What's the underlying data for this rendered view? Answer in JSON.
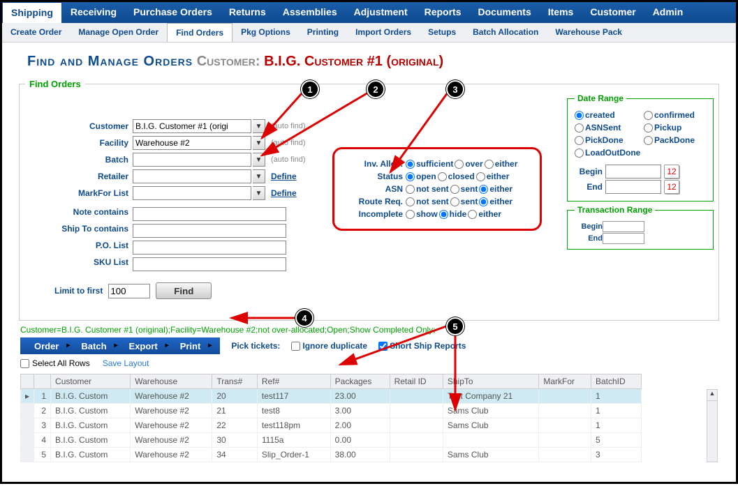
{
  "topnav": [
    "Shipping",
    "Receiving",
    "Purchase Orders",
    "Returns",
    "Assemblies",
    "Adjustment",
    "Reports",
    "Documents",
    "Items",
    "Customer",
    "Admin"
  ],
  "subnav": [
    "Create Order",
    "Manage Open Order",
    "Find Orders",
    "Pkg Options",
    "Printing",
    "Import Orders",
    "Setups",
    "Batch Allocation",
    "Warehouse Pack"
  ],
  "subnav_active": 2,
  "title": {
    "main": "Find and Manage Orders",
    "cust": "Customer:",
    "name": "B.I.G. Customer #1 (original)"
  },
  "section_legend": "Find Orders",
  "form": {
    "customer_lbl": "Customer",
    "customer_val": "B.I.G. Customer #1 (origi",
    "customer_auto": "(auto find)",
    "facility_lbl": "Facility",
    "facility_val": "Warehouse #2",
    "facility_auto": "(auto find)",
    "batch_lbl": "Batch",
    "batch_auto": "(auto find)",
    "retailer_lbl": "Retailer",
    "retailer_define": "Define",
    "markfor_lbl": "MarkFor List",
    "markfor_define": "Define",
    "note_lbl": "Note contains",
    "shipto_lbl": "Ship To contains",
    "po_lbl": "P.O. List",
    "sku_lbl": "SKU List"
  },
  "filters": {
    "inv_alloc": {
      "lbl": "Inv. Alloc.",
      "opts": [
        "sufficient",
        "over",
        "either"
      ],
      "sel": 0
    },
    "status": {
      "lbl": "Status",
      "opts": [
        "open",
        "closed",
        "either"
      ],
      "sel": 0
    },
    "asn": {
      "lbl": "ASN",
      "opts": [
        "not sent",
        "sent",
        "either"
      ],
      "sel": 2
    },
    "route": {
      "lbl": "Route Req.",
      "opts": [
        "not sent",
        "sent",
        "either"
      ],
      "sel": 2
    },
    "incomplete": {
      "lbl": "Incomplete",
      "opts": [
        "show",
        "hide",
        "either"
      ],
      "sel": 1
    }
  },
  "daterange": {
    "legend": "Date Range",
    "opts": [
      "created",
      "confirmed",
      "ASNSent",
      "Pickup",
      "PickDone",
      "PackDone",
      "LoadOutDone"
    ],
    "sel": 0,
    "begin_lbl": "Begin",
    "end_lbl": "End",
    "cal": "12"
  },
  "transrange": {
    "legend": "Transaction Range",
    "begin_lbl": "Begin",
    "end_lbl": "End"
  },
  "limit": {
    "lbl": "Limit to first",
    "val": "100",
    "btn": "Find"
  },
  "summary": "Customer=B.I.G. Customer #1 (original);Facility=Warehouse #2;not over-allocated;Open;Show Completed Only;",
  "menubar": [
    "Order",
    "Batch",
    "Export",
    "Print"
  ],
  "pick_tickets_lbl": "Pick tickets:",
  "ignore_dup": "Ignore duplicate",
  "short_ship": "Short Ship Reports",
  "select_all": "Select All Rows",
  "save_layout": "Save Layout",
  "table": {
    "cols": [
      "Customer",
      "Warehouse",
      "Trans#",
      "Ref#",
      "Packages",
      "Retail ID",
      "ShipTo",
      "MarkFor",
      "BatchID"
    ],
    "rows": [
      {
        "n": "1",
        "customer": "B.I.G. Custom",
        "warehouse": "Warehouse #2",
        "trans": "20",
        "ref": "test117",
        "pkg": "23.00",
        "retail": "",
        "shipto": "Test Company 21",
        "markfor": "",
        "batch": "1",
        "sel": true
      },
      {
        "n": "2",
        "customer": "B.I.G. Custom",
        "warehouse": "Warehouse #2",
        "trans": "21",
        "ref": "test8",
        "pkg": "3.00",
        "retail": "",
        "shipto": "Sams Club",
        "markfor": "",
        "batch": "1"
      },
      {
        "n": "3",
        "customer": "B.I.G. Custom",
        "warehouse": "Warehouse #2",
        "trans": "22",
        "ref": "test118pm",
        "pkg": "2.00",
        "retail": "",
        "shipto": "Sams Club",
        "markfor": "",
        "batch": "1"
      },
      {
        "n": "4",
        "customer": "B.I.G. Custom",
        "warehouse": "Warehouse #2",
        "trans": "30",
        "ref": "1115a",
        "pkg": "0.00",
        "retail": "",
        "shipto": "",
        "markfor": "",
        "batch": "5"
      },
      {
        "n": "5",
        "customer": "B.I.G. Custom",
        "warehouse": "Warehouse #2",
        "trans": "34",
        "ref": "Slip_Order-1",
        "pkg": "38.00",
        "retail": "",
        "shipto": "Sams Club",
        "markfor": "",
        "batch": "3"
      }
    ]
  },
  "callouts": [
    "1",
    "2",
    "3",
    "4",
    "5"
  ]
}
